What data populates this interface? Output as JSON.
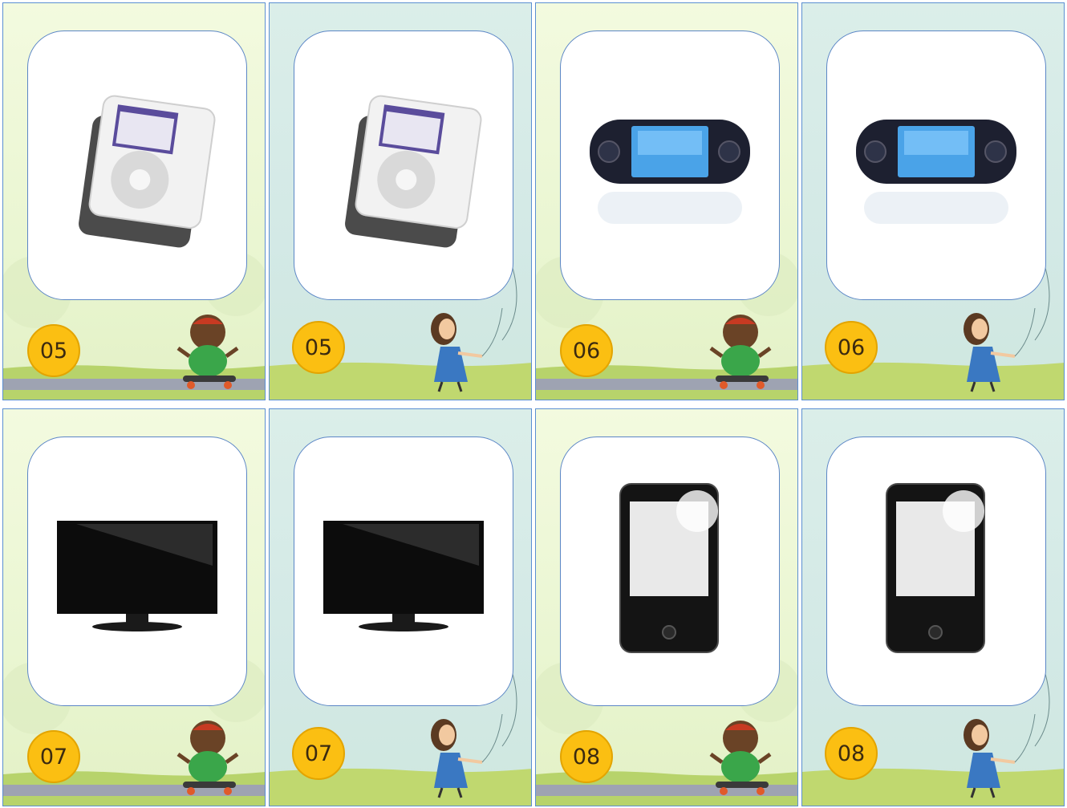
{
  "cards": [
    {
      "number": "05",
      "item_icon": "ipod-icon",
      "character": "boy-skateboard",
      "theme": "green"
    },
    {
      "number": "05",
      "item_icon": "ipod-icon",
      "character": "girl-kite",
      "theme": "blue"
    },
    {
      "number": "06",
      "item_icon": "psp-console-icon",
      "character": "boy-skateboard",
      "theme": "green"
    },
    {
      "number": "06",
      "item_icon": "psp-console-icon",
      "character": "girl-kite",
      "theme": "blue"
    },
    {
      "number": "07",
      "item_icon": "tv-monitor-icon",
      "character": "boy-skateboard",
      "theme": "green"
    },
    {
      "number": "07",
      "item_icon": "tv-monitor-icon",
      "character": "girl-kite",
      "theme": "blue"
    },
    {
      "number": "08",
      "item_icon": "smartphone-icon",
      "character": "boy-skateboard",
      "theme": "green"
    },
    {
      "number": "08",
      "item_icon": "smartphone-icon",
      "character": "girl-kite",
      "theme": "blue"
    }
  ],
  "colors": {
    "badge": "#fbbf12",
    "frame_border": "#5b86c6",
    "card_border": "#5b8fd1"
  }
}
